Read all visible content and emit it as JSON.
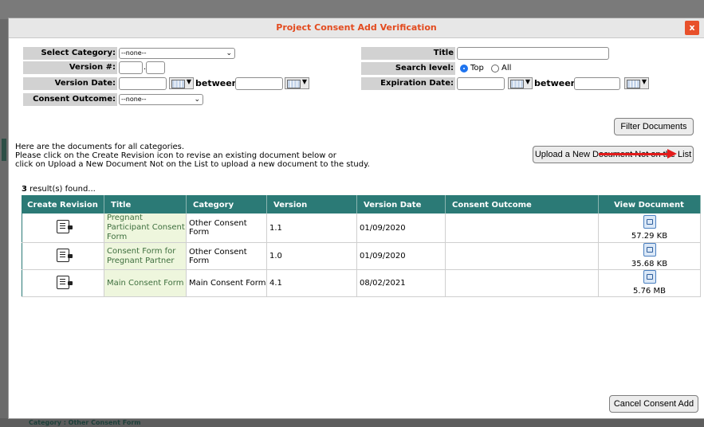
{
  "dialog": {
    "title": "Project Consent Add Verification",
    "close_label": "x"
  },
  "filters": {
    "category_label": "Select Category:",
    "category_value": "--none--",
    "version_label": "Version #:",
    "version_sep": ".",
    "version_date_label": "Version Date:",
    "between_label": "between",
    "consent_outcome_label": "Consent Outcome:",
    "consent_outcome_value": "--none--",
    "title_label": "Title",
    "search_level_label": "Search level:",
    "search_level_options": [
      "Top",
      "All"
    ],
    "search_level_selected": "Top",
    "expiration_date_label": "Expiration Date:"
  },
  "buttons": {
    "filter": "Filter Documents",
    "upload": "Upload a New Document Not on the List",
    "cancel": "Cancel Consent Add"
  },
  "intro": [
    "Here are the documents for all categories.",
    "Please click on the Create Revision icon to revise an existing document below or",
    "click on Upload a New Document Not on the List to upload a new document to the study."
  ],
  "results": {
    "count": "3",
    "suffix": " result(s) found..."
  },
  "table": {
    "columns": [
      "Create Revision",
      "Title",
      "Category",
      "Version",
      "Version Date",
      "Consent Outcome",
      "View Document"
    ],
    "rows": [
      {
        "title": "Pregnant Participant Consent Form",
        "category": "Other Consent Form",
        "version": "1.1",
        "version_date": "01/09/2020",
        "consent_outcome": "",
        "size": "57.29 KB"
      },
      {
        "title": "Consent Form for Pregnant Partner",
        "category": "Other Consent Form",
        "version": "1.0",
        "version_date": "01/09/2020",
        "consent_outcome": "",
        "size": "35.68 KB"
      },
      {
        "title": "Main Consent Form",
        "category": "Main Consent Form",
        "version": "4.1",
        "version_date": "08/02/2021",
        "consent_outcome": "",
        "size": "5.76 MB"
      }
    ]
  },
  "background": {
    "bottom_text": "Category : Other Consent Form"
  },
  "colors": {
    "accent": "#2b7a76",
    "title": "#e34b1f",
    "annotation_arrow": "#e31b1b"
  },
  "icons": [
    "close-icon",
    "chevron-down-icon",
    "calendar-icon",
    "create-revision-icon",
    "view-document-icon"
  ]
}
